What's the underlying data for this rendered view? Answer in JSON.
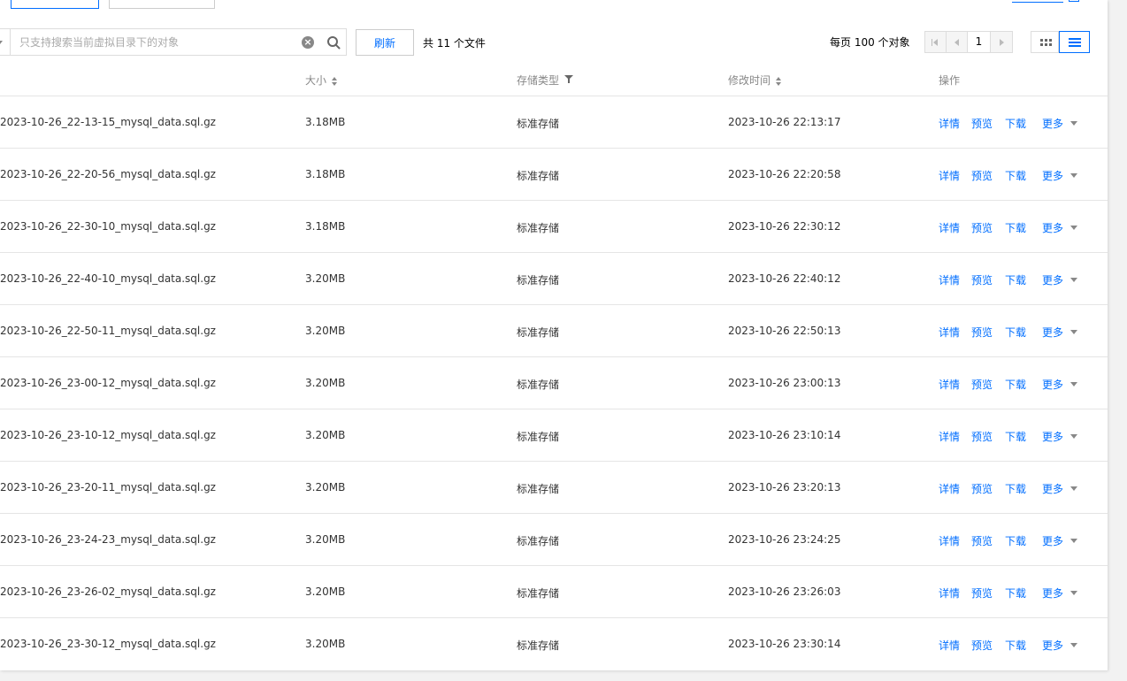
{
  "toolbar": {
    "search_placeholder": "只支持搜索当前虚拟目录下的对象",
    "refresh_label": "刷新",
    "total_text": "共 11 个文件",
    "per_page_text": "每页 100 个对象",
    "current_page": "1"
  },
  "table": {
    "headers": {
      "size": "大小",
      "storage_type": "存储类型",
      "modified": "修改时间",
      "actions": "操作"
    },
    "action_labels": [
      "详情",
      "预览",
      "下载",
      "更多"
    ],
    "rows": [
      {
        "name": "2023-10-26_22-13-15_mysql_data.sql.gz",
        "size": "3.18MB",
        "type": "标准存储",
        "time": "2023-10-26 22:13:17"
      },
      {
        "name": "2023-10-26_22-20-56_mysql_data.sql.gz",
        "size": "3.18MB",
        "type": "标准存储",
        "time": "2023-10-26 22:20:58"
      },
      {
        "name": "2023-10-26_22-30-10_mysql_data.sql.gz",
        "size": "3.18MB",
        "type": "标准存储",
        "time": "2023-10-26 22:30:12"
      },
      {
        "name": "2023-10-26_22-40-10_mysql_data.sql.gz",
        "size": "3.20MB",
        "type": "标准存储",
        "time": "2023-10-26 22:40:12"
      },
      {
        "name": "2023-10-26_22-50-11_mysql_data.sql.gz",
        "size": "3.20MB",
        "type": "标准存储",
        "time": "2023-10-26 22:50:13"
      },
      {
        "name": "2023-10-26_23-00-12_mysql_data.sql.gz",
        "size": "3.20MB",
        "type": "标准存储",
        "time": "2023-10-26 23:00:13"
      },
      {
        "name": "2023-10-26_23-10-12_mysql_data.sql.gz",
        "size": "3.20MB",
        "type": "标准存储",
        "time": "2023-10-26 23:10:14"
      },
      {
        "name": "2023-10-26_23-20-11_mysql_data.sql.gz",
        "size": "3.20MB",
        "type": "标准存储",
        "time": "2023-10-26 23:20:13"
      },
      {
        "name": "2023-10-26_23-24-23_mysql_data.sql.gz",
        "size": "3.20MB",
        "type": "标准存储",
        "time": "2023-10-26 23:24:25"
      },
      {
        "name": "2023-10-26_23-26-02_mysql_data.sql.gz",
        "size": "3.20MB",
        "type": "标准存储",
        "time": "2023-10-26 23:26:03"
      },
      {
        "name": "2023-10-26_23-30-12_mysql_data.sql.gz",
        "size": "3.20MB",
        "type": "标准存储",
        "time": "2023-10-26 23:30:14"
      }
    ]
  },
  "colors": {
    "accent": "#006eff",
    "text": "#333333",
    "header_text": "#888888",
    "border": "#e5e5e5"
  },
  "icons": [
    "chevron-down-icon",
    "clear-icon",
    "search-icon",
    "first-page-icon",
    "prev-page-icon",
    "next-page-icon",
    "grid-view-icon",
    "list-view-icon",
    "sort-icon",
    "filter-icon",
    "caret-down-icon"
  ]
}
